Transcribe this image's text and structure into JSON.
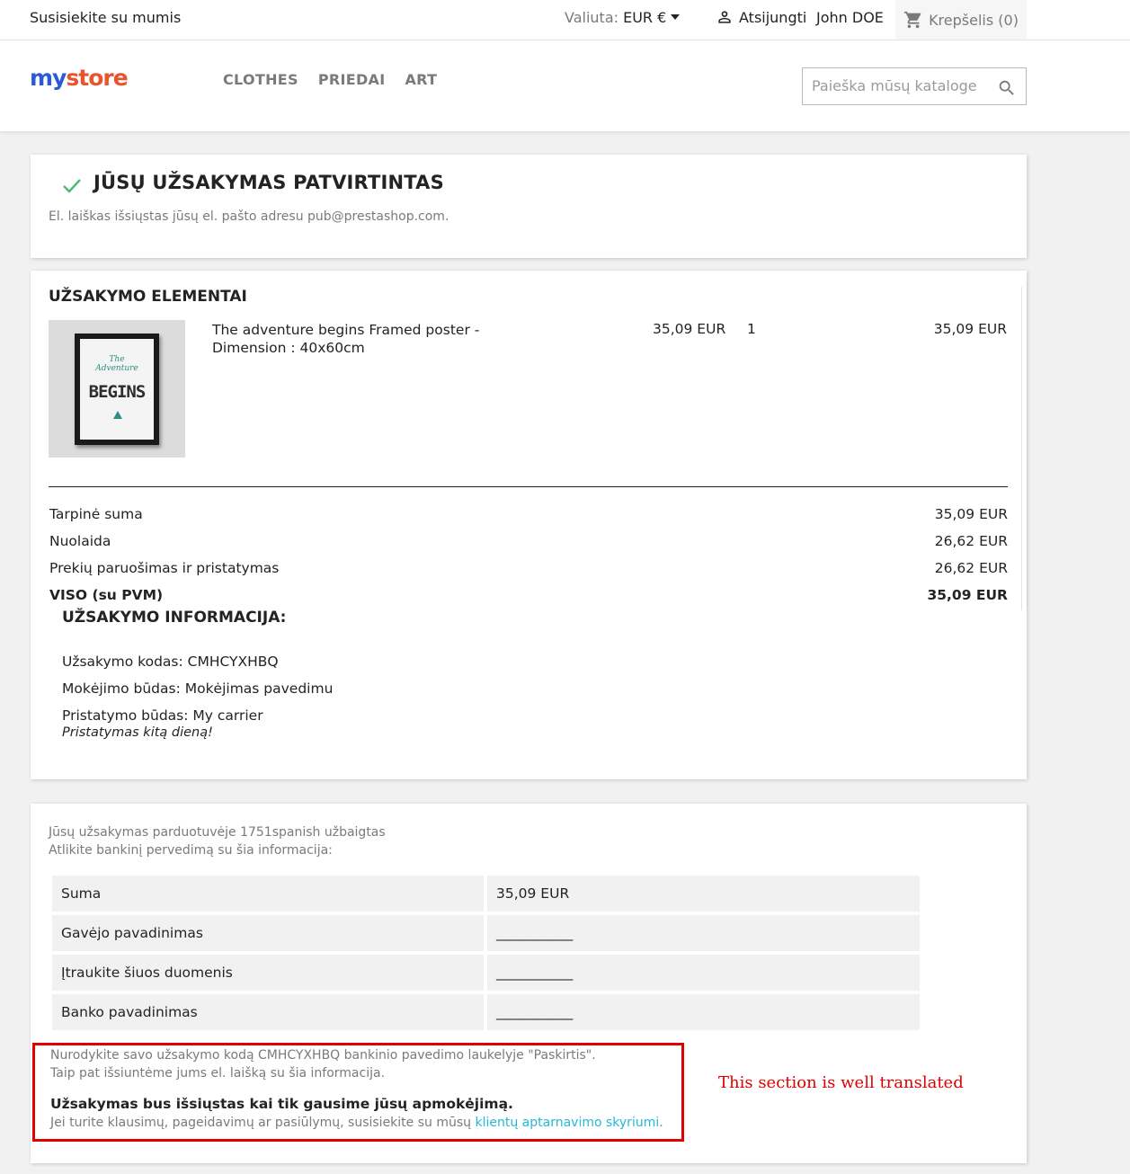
{
  "topbar": {
    "contact": "Susisiekite su mumis",
    "currency_label": "Valiuta:",
    "currency_value": "EUR €",
    "logout": "Atsijungti",
    "username": "John DOE",
    "cart": "Krepšelis (0)"
  },
  "header": {
    "logo": [
      "my",
      " ",
      "store"
    ],
    "menu": [
      "CLOTHES",
      "PRIEDAI",
      "ART"
    ],
    "search_placeholder": "Paieška mūsų kataloge"
  },
  "confirmation": {
    "title": "JŪSŲ UŽSAKYMAS PATVIRTINTAS",
    "subtitle": "El. laiškas išsiųstas jūsų el. pašto adresu pub@prestashop.com."
  },
  "items": {
    "title": "UŽSAKYMO ELEMENTAI",
    "product": {
      "name": "The adventure begins Framed poster - Dimension : 40x60cm",
      "price": "35,09 EUR",
      "qty": "1",
      "total": "35,09 EUR",
      "poster_line1": "The\nAdventure",
      "poster_line2": "BEGINS"
    },
    "totals": [
      {
        "label": "Tarpinė suma",
        "value": "35,09 EUR"
      },
      {
        "label": "Nuolaida",
        "value": "26,62 EUR"
      },
      {
        "label": "Prekių paruošimas ir pristatymas",
        "value": "26,62 EUR"
      },
      {
        "label": "VISO (su PVM)",
        "value": "35,09 EUR"
      }
    ]
  },
  "order_info": {
    "title": "UŽSAKYMO INFORMACIJA:",
    "code": "Užsakymo kodas: CMHCYXHBQ",
    "payment": "Mokėjimo būdas: Mokėjimas pavedimu",
    "shipping": "Pristatymo būdas: My carrier",
    "shipping_note": "Pristatymas kitą dieną!"
  },
  "payment": {
    "intro1": "Jūsų užsakymas parduotuvėje 1751spanish užbaigtas",
    "intro2": "Atlikite bankinį pervedimą su šia informacija:",
    "rows": [
      {
        "key": "Suma",
        "value": "35,09 EUR"
      },
      {
        "key": "Gavėjo pavadinimas",
        "value": "___________"
      },
      {
        "key": "Įtraukite šiuos duomenis",
        "value": "___________"
      },
      {
        "key": "Banko pavadinimas",
        "value": "___________"
      }
    ],
    "note1": "Nurodykite savo užsakymo kodą CMHCYXHBQ bankinio pavedimo laukelyje \"Paskirtis\".",
    "note2": "Taip pat išsiuntėme jums el. laišką su šia informacija.",
    "note_bold": "Užsakymas bus išsiųstas kai tik gausime jūsų apmokėjimą.",
    "note3_prefix": "Jei turite klausimų, pageidavimų ar pasiūlymų, susisiekite su mūsų ",
    "note3_link": "klientų aptarnavimo skyriumi",
    "note3_suffix": ".",
    "annotation": "This section is well translated"
  },
  "colors": {
    "accent": "#24b9d7",
    "check": "#4cbb6c",
    "highlight": "#e00000"
  }
}
